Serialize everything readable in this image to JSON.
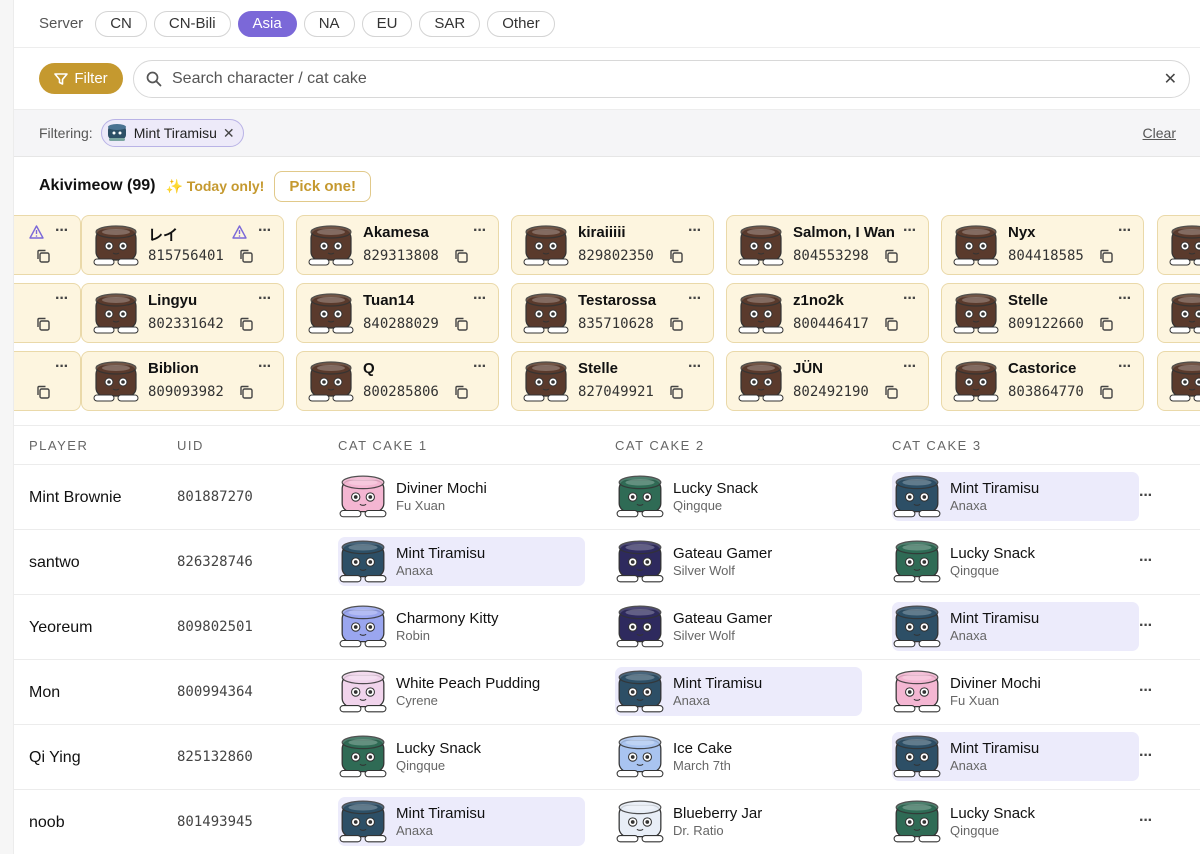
{
  "colors": {
    "accent_purple": "#7b68d8",
    "accent_gold": "#c5992f",
    "card_bg": "#fdf5df",
    "highlight_bg": "#ecebfb"
  },
  "server": {
    "label": "Server",
    "options": [
      "CN",
      "CN-Bili",
      "Asia",
      "NA",
      "EU",
      "SAR",
      "Other"
    ],
    "selected": "Asia"
  },
  "search": {
    "filter_label": "Filter",
    "placeholder": "Search character / cat cake",
    "clear_icon": "close-icon"
  },
  "filtering": {
    "label": "Filtering:",
    "tag": "Mint Tiramisu",
    "clear": "Clear"
  },
  "section": {
    "title": "Akivimeow (99)",
    "today": "✨ Today only!",
    "pick": "Pick one!"
  },
  "cards": [
    [
      {
        "name": "",
        "uid": "",
        "warn": true
      },
      {
        "name": "レイ",
        "uid": "815756401",
        "warn": true
      },
      {
        "name": "Akamesa",
        "uid": "829313808"
      },
      {
        "name": "kiraiiiii",
        "uid": "829802350"
      },
      {
        "name": "Salmon, I Wan",
        "uid": "804553298"
      },
      {
        "name": "Nyx",
        "uid": "804418585"
      },
      {
        "name": "",
        "uid": ""
      }
    ],
    [
      {
        "name": "",
        "uid": ""
      },
      {
        "name": "Lingyu",
        "uid": "802331642"
      },
      {
        "name": "Tuan14",
        "uid": "840288029"
      },
      {
        "name": "Testarossa",
        "uid": "835710628"
      },
      {
        "name": "z1no2k",
        "uid": "800446417"
      },
      {
        "name": "Stelle",
        "uid": "809122660"
      },
      {
        "name": "",
        "uid": ""
      }
    ],
    [
      {
        "name": "",
        "uid": ""
      },
      {
        "name": "Biblion",
        "uid": "809093982"
      },
      {
        "name": "Q",
        "uid": "800285806"
      },
      {
        "name": "Stelle",
        "uid": "827049921"
      },
      {
        "name": "JÜN",
        "uid": "802492190"
      },
      {
        "name": "Castorice",
        "uid": "803864770"
      },
      {
        "name": "",
        "uid": ""
      }
    ]
  ],
  "table": {
    "headers": [
      "PLAYER",
      "UID",
      "CAT CAKE 1",
      "CAT CAKE 2",
      "CAT CAKE 3"
    ],
    "rows": [
      {
        "player": "Mint Brownie",
        "uid": "801887270",
        "cakes": [
          {
            "name": "Diviner Mochi",
            "char": "Fu Xuan",
            "color": "#f4b6d2"
          },
          {
            "name": "Lucky Snack",
            "char": "Qingque",
            "color": "#2f6b55"
          },
          {
            "name": "Mint Tiramisu",
            "char": "Anaxa",
            "color": "#2d4f66",
            "hl": true
          }
        ]
      },
      {
        "player": "santwo",
        "uid": "826328746",
        "cakes": [
          {
            "name": "Mint Tiramisu",
            "char": "Anaxa",
            "color": "#2d4f66",
            "hl": true
          },
          {
            "name": "Gateau Gamer",
            "char": "Silver Wolf",
            "color": "#2e2a5e"
          },
          {
            "name": "Lucky Snack",
            "char": "Qingque",
            "color": "#2f6b55"
          }
        ]
      },
      {
        "player": "Yeoreum",
        "uid": "809802501",
        "cakes": [
          {
            "name": "Charmony Kitty",
            "char": "Robin",
            "color": "#9aa6ef"
          },
          {
            "name": "Gateau Gamer",
            "char": "Silver Wolf",
            "color": "#2e2a5e"
          },
          {
            "name": "Mint Tiramisu",
            "char": "Anaxa",
            "color": "#2d4f66",
            "hl": true
          }
        ]
      },
      {
        "player": "Mon",
        "uid": "800994364",
        "cakes": [
          {
            "name": "White Peach Pudding",
            "char": "Cyrene",
            "color": "#f1d4ec"
          },
          {
            "name": "Mint Tiramisu",
            "char": "Anaxa",
            "color": "#2d4f66",
            "hl": true
          },
          {
            "name": "Diviner Mochi",
            "char": "Fu Xuan",
            "color": "#f4b6d2"
          }
        ]
      },
      {
        "player": "Qi Ying",
        "uid": "825132860",
        "cakes": [
          {
            "name": "Lucky Snack",
            "char": "Qingque",
            "color": "#2f6b55"
          },
          {
            "name": "Ice Cake",
            "char": "March 7th",
            "color": "#a9c4f0"
          },
          {
            "name": "Mint Tiramisu",
            "char": "Anaxa",
            "color": "#2d4f66",
            "hl": true
          }
        ]
      },
      {
        "player": "noob",
        "uid": "801493945",
        "cakes": [
          {
            "name": "Mint Tiramisu",
            "char": "Anaxa",
            "color": "#2d4f66",
            "hl": true
          },
          {
            "name": "Blueberry Jar",
            "char": "Dr. Ratio",
            "color": "#e8eef7"
          },
          {
            "name": "Lucky Snack",
            "char": "Qingque",
            "color": "#2f6b55"
          }
        ]
      }
    ]
  }
}
